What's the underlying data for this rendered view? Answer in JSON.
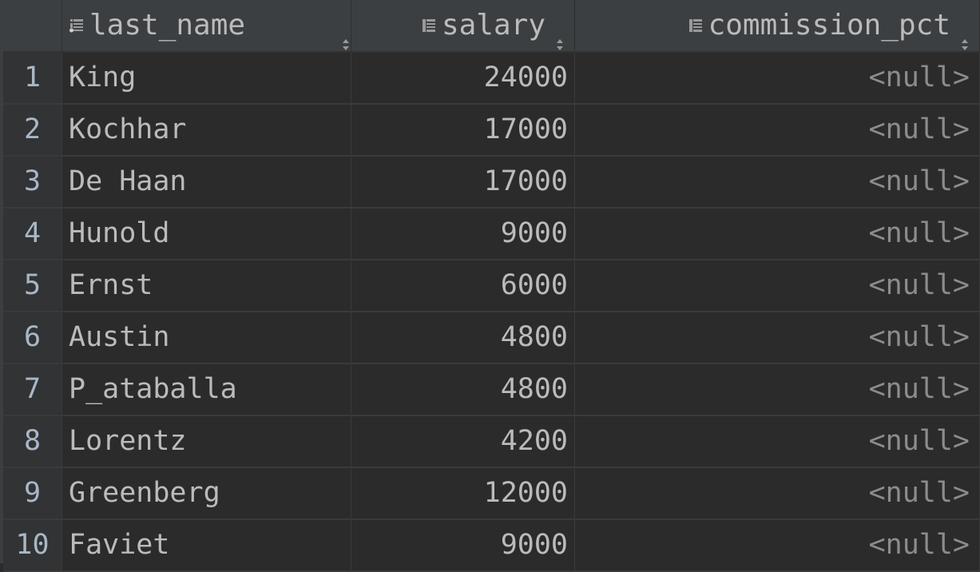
{
  "columns": [
    {
      "name": "last_name",
      "icon": "key-column-icon"
    },
    {
      "name": "salary",
      "icon": "column-icon"
    },
    {
      "name": "commission_pct",
      "icon": "column-icon"
    }
  ],
  "rows": [
    {
      "num": "1",
      "last_name": "King",
      "salary": "24000",
      "commission_pct": "<null>"
    },
    {
      "num": "2",
      "last_name": "Kochhar",
      "salary": "17000",
      "commission_pct": "<null>"
    },
    {
      "num": "3",
      "last_name": "De Haan",
      "salary": "17000",
      "commission_pct": "<null>"
    },
    {
      "num": "4",
      "last_name": "Hunold",
      "salary": "9000",
      "commission_pct": "<null>"
    },
    {
      "num": "5",
      "last_name": "Ernst",
      "salary": "6000",
      "commission_pct": "<null>"
    },
    {
      "num": "6",
      "last_name": "Austin",
      "salary": "4800",
      "commission_pct": "<null>"
    },
    {
      "num": "7",
      "last_name": "P_ataballa",
      "salary": "4800",
      "commission_pct": "<null>"
    },
    {
      "num": "8",
      "last_name": "Lorentz",
      "salary": "4200",
      "commission_pct": "<null>"
    },
    {
      "num": "9",
      "last_name": "Greenberg",
      "salary": "12000",
      "commission_pct": "<null>"
    },
    {
      "num": "10",
      "last_name": "Faviet",
      "salary": "9000",
      "commission_pct": "<null>"
    }
  ],
  "colors": {
    "background": "#2b2b2b",
    "header": "#3c3f41",
    "text": "#bbbbbb",
    "null_text": "#8c8c8c"
  }
}
